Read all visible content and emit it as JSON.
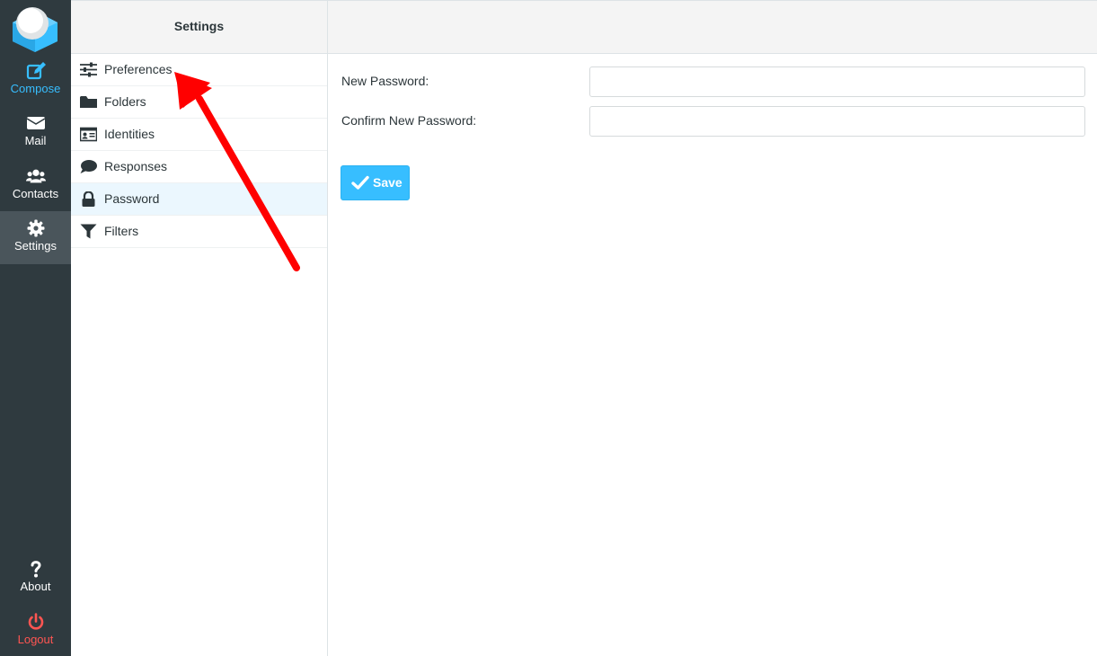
{
  "nav": {
    "items": [
      {
        "label": "Compose",
        "icon": "compose-icon"
      },
      {
        "label": "Mail",
        "icon": "envelope-icon"
      },
      {
        "label": "Contacts",
        "icon": "users-icon"
      },
      {
        "label": "Settings",
        "icon": "gear-icon"
      },
      {
        "label": "About",
        "icon": "question-icon"
      },
      {
        "label": "Logout",
        "icon": "power-icon"
      }
    ],
    "active": "Settings"
  },
  "settings_pane": {
    "title": "Settings",
    "items": [
      {
        "label": "Preferences",
        "icon": "sliders-icon"
      },
      {
        "label": "Folders",
        "icon": "folder-icon"
      },
      {
        "label": "Identities",
        "icon": "id-card-icon"
      },
      {
        "label": "Responses",
        "icon": "speech-bubble-icon"
      },
      {
        "label": "Password",
        "icon": "lock-icon"
      },
      {
        "label": "Filters",
        "icon": "filter-icon"
      }
    ],
    "selected": "Password"
  },
  "password_form": {
    "new_password_label": "New Password:",
    "new_password_value": "",
    "confirm_password_label": "Confirm New Password:",
    "confirm_password_value": "",
    "save_label": "Save"
  },
  "colors": {
    "nav_bg": "#2f3a3f",
    "accent": "#37beff",
    "logout": "#ff5552",
    "annotation_arrow": "#ff0000"
  }
}
